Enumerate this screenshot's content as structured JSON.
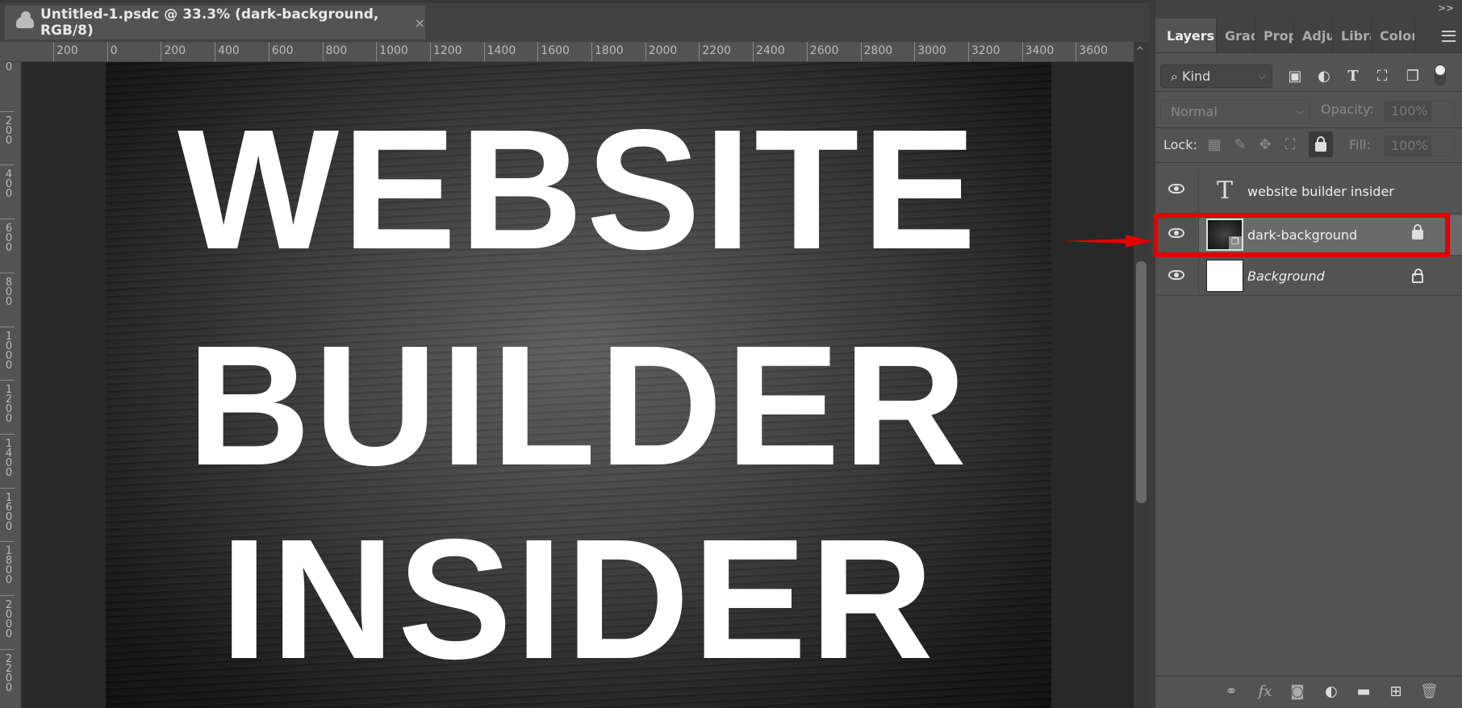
{
  "document": {
    "tab_title": "Untitled-1.psdc @ 33.3% (dark-background, RGB/8)",
    "close_label": "×",
    "canvas_text": [
      "WEBSITE",
      "BUILDER",
      "INSIDER"
    ]
  },
  "rulers": {
    "horizontal": [
      "200",
      "0",
      "200",
      "400",
      "600",
      "800",
      "1000",
      "1200",
      "1400",
      "1600",
      "1800",
      "2000",
      "2200",
      "2400",
      "2600",
      "2800",
      "3000",
      "3200",
      "3400",
      "3600"
    ],
    "vertical": [
      "0",
      "200",
      "400",
      "600",
      "800",
      "1000",
      "1200",
      "1400",
      "1600",
      "1800",
      "2000",
      "2200"
    ]
  },
  "panel": {
    "collapse_label": ">>",
    "tabs": [
      "Layers",
      "Grad",
      "Prop",
      "Adju",
      "Libra",
      "Color"
    ],
    "filter": {
      "kind_label": "Kind"
    },
    "blend_mode": "Normal",
    "opacity_label": "Opacity:",
    "opacity_value": "100%",
    "lock_label": "Lock:",
    "fill_label": "Fill:",
    "fill_value": "100%",
    "layers": [
      {
        "name": "website builder insider",
        "type": "text"
      },
      {
        "name": "dark-background",
        "type": "smart-object",
        "selected": true,
        "locked": true
      },
      {
        "name": "Background",
        "type": "pixel",
        "locked": true
      }
    ]
  },
  "colors": {
    "highlight": "#e30000",
    "panel": "#535353",
    "pasteboard": "#282828"
  }
}
